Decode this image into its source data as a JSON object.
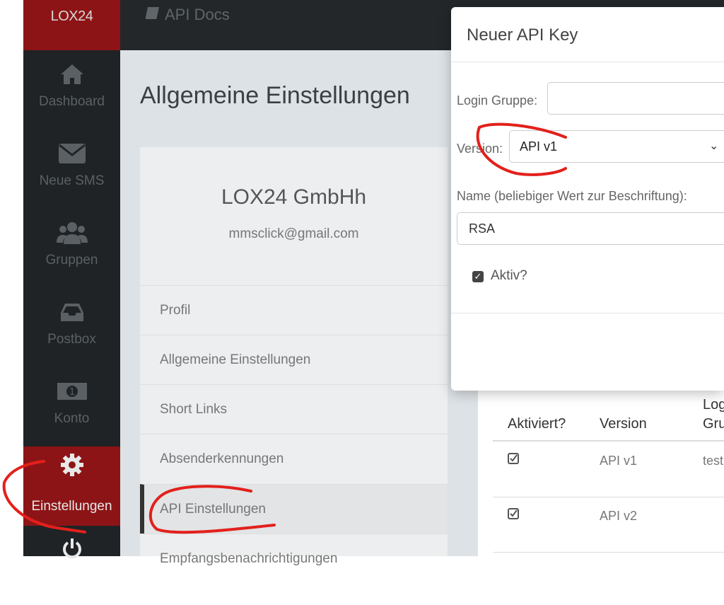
{
  "brand": "LOX24",
  "topbar": {
    "apidocs_label": "API Docs"
  },
  "nav": [
    {
      "label": "Dashboard",
      "icon": "home-icon"
    },
    {
      "label": "Neue SMS",
      "icon": "envelope-icon"
    },
    {
      "label": "Gruppen",
      "icon": "users-icon"
    },
    {
      "label": "Postbox",
      "icon": "inbox-icon"
    },
    {
      "label": "Konto",
      "icon": "money-icon"
    },
    {
      "label": "Einstellungen",
      "icon": "gear-icon",
      "active": true
    },
    {
      "label": "",
      "icon": "power-icon"
    }
  ],
  "page": {
    "title": "Allgemeine Einstellungen",
    "company": "LOX24 GmbHh",
    "email": "mmsclick@gmail.com",
    "menu": [
      "Profil",
      "Allgemeine Einstellungen",
      "Short Links",
      "Absenderkennungen",
      "API Einstellungen",
      "Empfangsbenachrichtigungen"
    ]
  },
  "table": {
    "headers": [
      "Aktiviert?",
      "Version",
      "Log",
      "Gru"
    ],
    "rows": [
      {
        "version": "API v1",
        "login": "test"
      },
      {
        "version": "API v2",
        "login": ""
      }
    ]
  },
  "modal": {
    "title": "Neuer API Key",
    "login_label": "Login Gruppe:",
    "login_value": "",
    "version_label": "Version:",
    "version_value": "API v1",
    "name_label": "Name (beliebiger Wert zur Beschriftung):",
    "name_value": "RSA",
    "active_label": "Aktiv?"
  },
  "colors": {
    "sidebar": "#1f2325",
    "accent": "#8d1416",
    "scribble": "#e3201b"
  }
}
